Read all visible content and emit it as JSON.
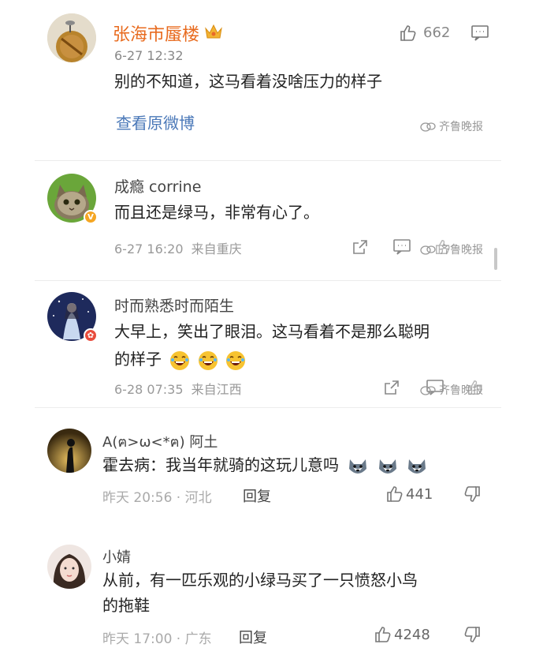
{
  "watermark": "齐鲁晚报",
  "comments": [
    {
      "name": "张海市蜃楼",
      "time": "6-27 12:32",
      "text": "别的不知道，这马看着没啥压力的样子",
      "likes": "662",
      "link": "查看原微博"
    },
    {
      "name": "成瘾 corrine",
      "text": "而且还是绿马，非常有心了。",
      "meta": "6-27 16:20  来自重庆"
    },
    {
      "name": "时而熟悉时而陌生",
      "text_line1": "大早上，笑出了眼泪。这马看着不是那么聪明",
      "text_line2": "的样子",
      "meta": "6-28 07:35  来自江西"
    },
    {
      "name": "A(ฅ>ω<*ฅ) 阿土",
      "text": "霍去病：我当年就骑的这玩儿意吗",
      "meta": "昨天 20:56 · 河北",
      "reply": "回复",
      "likes": "441"
    },
    {
      "name": "小婧",
      "text_line1": "从前，有一匹乐观的小绿马买了一只愤怒小鸟",
      "text_line2": "的拖鞋",
      "meta": "昨天 17:00 · 广东",
      "reply": "回复",
      "likes": "4248"
    }
  ],
  "colors": {
    "orange_name": "#e86b1f",
    "link": "#4a78b8",
    "gray": "#999999"
  }
}
